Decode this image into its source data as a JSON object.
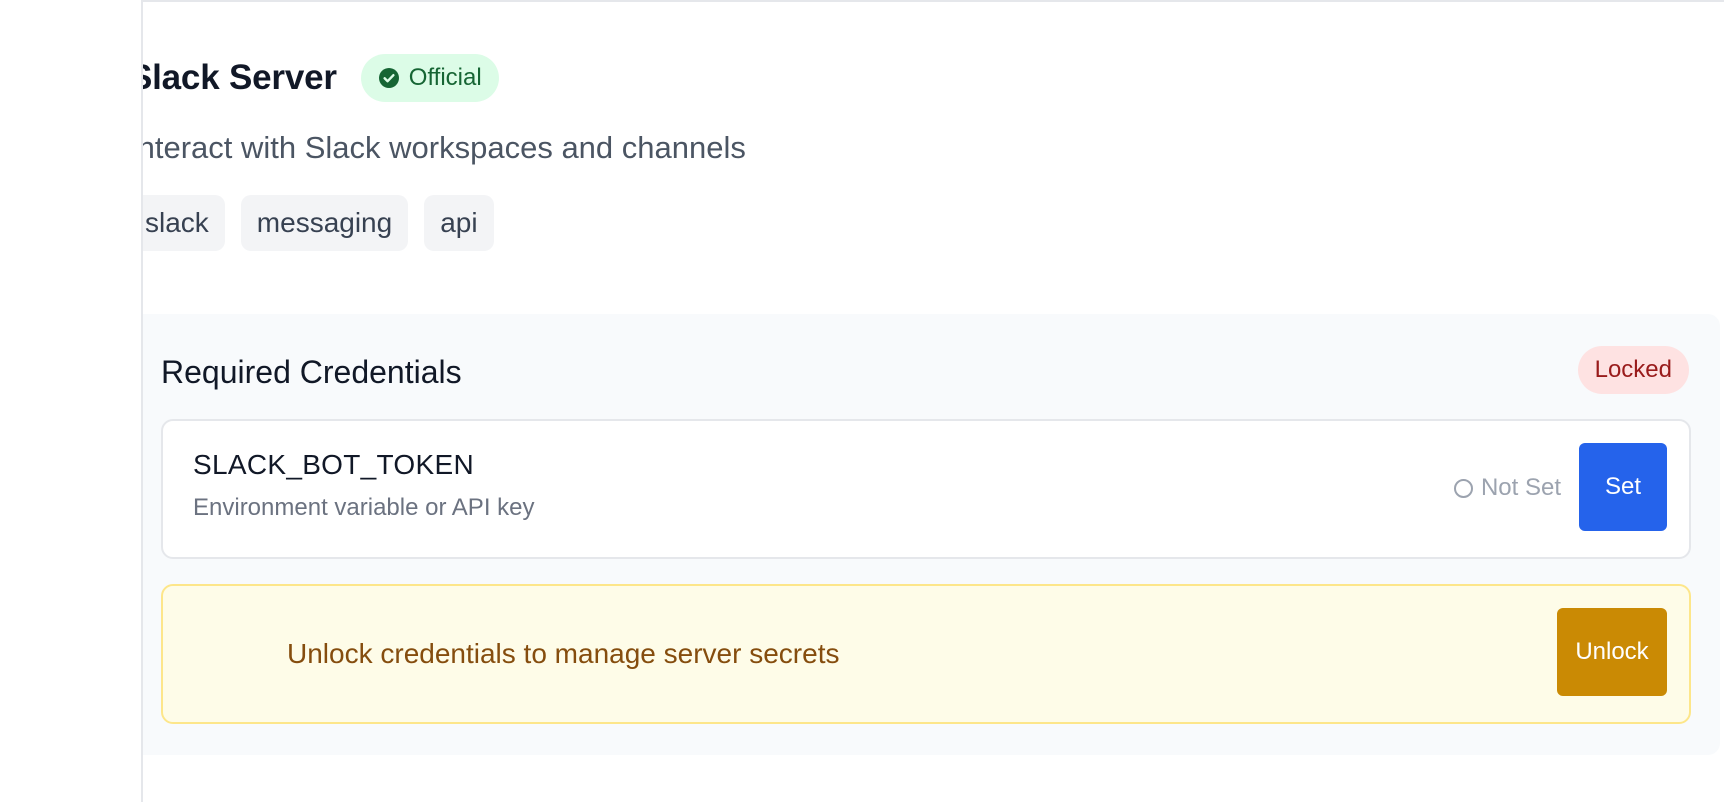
{
  "server": {
    "title": "Slack Server",
    "badge_label": "Official",
    "description": "Interact with Slack workspaces and channels",
    "tags": [
      "slack",
      "messaging",
      "api"
    ]
  },
  "credentials": {
    "heading": "Required Credentials",
    "lock_status": "Locked",
    "items": [
      {
        "name": "SLACK_BOT_TOKEN",
        "description": "Environment variable or API key",
        "status": "Not Set",
        "action_label": "Set"
      }
    ],
    "unlock_message": "Unlock credentials to manage server secrets",
    "unlock_label": "Unlock"
  },
  "icons": {
    "official": "check-circle-icon",
    "delete": "trash-icon",
    "status": "circle-icon"
  },
  "colors": {
    "official_bg": "#dcfce7",
    "official_text": "#166534",
    "locked_bg": "#fee2e2",
    "locked_text": "#991b1b",
    "set_button": "#2563eb",
    "unlock_button": "#ca8a04",
    "unlock_banner_bg": "#fefce8",
    "delete_icon": "#dc2626"
  }
}
